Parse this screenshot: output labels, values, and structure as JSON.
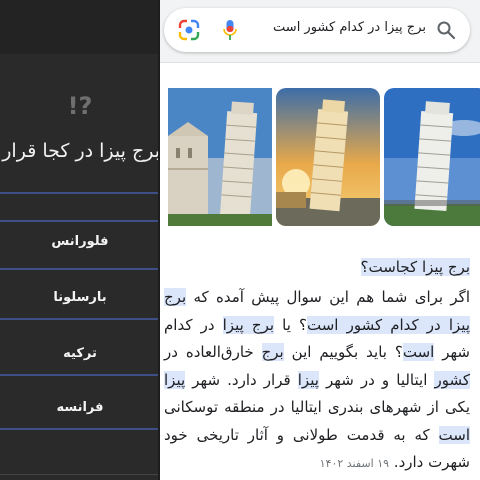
{
  "quiz": {
    "question_mark_icon": "!?",
    "question": "برج پیزا در کجا قرار دارد",
    "options": [
      "فلورانس",
      "بارسلونا",
      "ترکیه",
      "فرانسه"
    ]
  },
  "search": {
    "query": "برج پیزا در کدام کشور است",
    "icons": {
      "search": "search-icon",
      "mic": "mic-icon",
      "lens": "google-lens-icon"
    }
  },
  "snippet": {
    "question": "برج پیزا کجاست؟",
    "date": "۱۹ اسفند ۱۴۰۲",
    "segments": [
      {
        "t": "اگر برای شما هم این سوال پیش آمده که ",
        "h": false
      },
      {
        "t": "برج",
        "h": true
      },
      {
        "t": " ",
        "h": false
      },
      {
        "t": "پیزا در کدام کشور است",
        "h": true
      },
      {
        "t": "؟ یا ",
        "h": false
      },
      {
        "t": "برج پیزا",
        "h": true
      },
      {
        "t": " در کدام شهر ",
        "h": false
      },
      {
        "t": "است",
        "h": true
      },
      {
        "t": "؟ باید بگوییم این ",
        "h": false
      },
      {
        "t": "برج",
        "h": true
      },
      {
        "t": " خارق‌العاده در ",
        "h": false
      },
      {
        "t": "کشور",
        "h": true
      },
      {
        "t": " ایتالیا و در شهر ",
        "h": false
      },
      {
        "t": "پیزا",
        "h": true
      },
      {
        "t": " قرار دارد. شهر ",
        "h": false
      },
      {
        "t": "پیزا",
        "h": true
      },
      {
        "t": " یکی از شهرهای بندری ایتالیا در منطقه توسکانی ",
        "h": false
      },
      {
        "t": "است",
        "h": true
      },
      {
        "t": " که به قدمت طولانی و آثار تاریخی خود شهرت دارد. ",
        "h": false
      }
    ]
  },
  "colors": {
    "highlight": "#dbe6fb",
    "quiz_bg": "#2a2a2a",
    "divider": "#3d4f86"
  }
}
